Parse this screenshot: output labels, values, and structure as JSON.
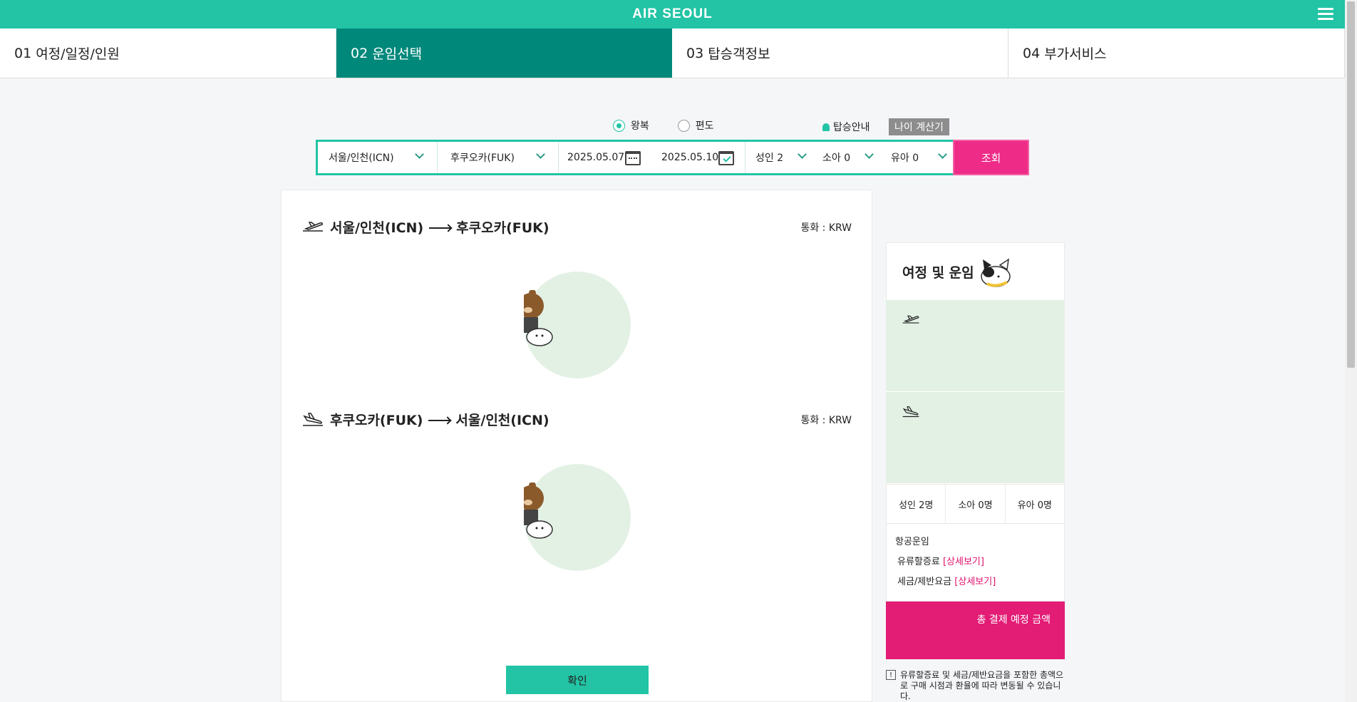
{
  "header": {
    "logo": "AIR SEOUL",
    "menu_icon": "hamburger-menu-icon"
  },
  "steps": [
    {
      "num": "01",
      "label": "여정/일정/인원",
      "active": false
    },
    {
      "num": "02",
      "label": "운임선택",
      "active": true
    },
    {
      "num": "03",
      "label": "탑승객정보",
      "active": false
    },
    {
      "num": "04",
      "label": "부가서비스",
      "active": false
    }
  ],
  "trip_type": {
    "round_trip": "왕복",
    "one_way": "편도",
    "selected": "왕복"
  },
  "links": {
    "boarding_info": "탑승안내",
    "age_calculator": "나이 계산기"
  },
  "search": {
    "origin": "서울/인천(ICN)",
    "destination": "후쿠오카(FUK)",
    "depart_date": "2025.05.07",
    "return_date": "2025.05.10",
    "adult": "성인 2",
    "child": "소아 0",
    "infant": "유아 0",
    "button": "조회"
  },
  "outbound": {
    "from": "서울/인천(ICN)",
    "to": "후쿠오카(FUK)",
    "currency": "통화 : KRW"
  },
  "inbound": {
    "from": "후쿠오카(FUK)",
    "to": "서울/인천(ICN)",
    "currency": "통화 : KRW"
  },
  "confirm_button": "확인",
  "summary": {
    "title": "여정 및 운임",
    "adult": "성인 2명",
    "child": "소아 0명",
    "infant": "유아 0명",
    "air_fare": "항공운임",
    "fuel_surcharge": "유류할증료",
    "tax": "세금/제반요금",
    "detail_link": "[상세보기]",
    "total_label": "총 결제 예정 금액",
    "footnote": "유류할증료 및 세금/제반요금을 포함한 총액으로 구매 시점과 환율에 따라 변동될 수 있습니다."
  },
  "colors": {
    "brand": "#22c4a5",
    "active_step": "#00897b",
    "accent": "#ee2b87",
    "light_green": "#e3f1e5"
  }
}
